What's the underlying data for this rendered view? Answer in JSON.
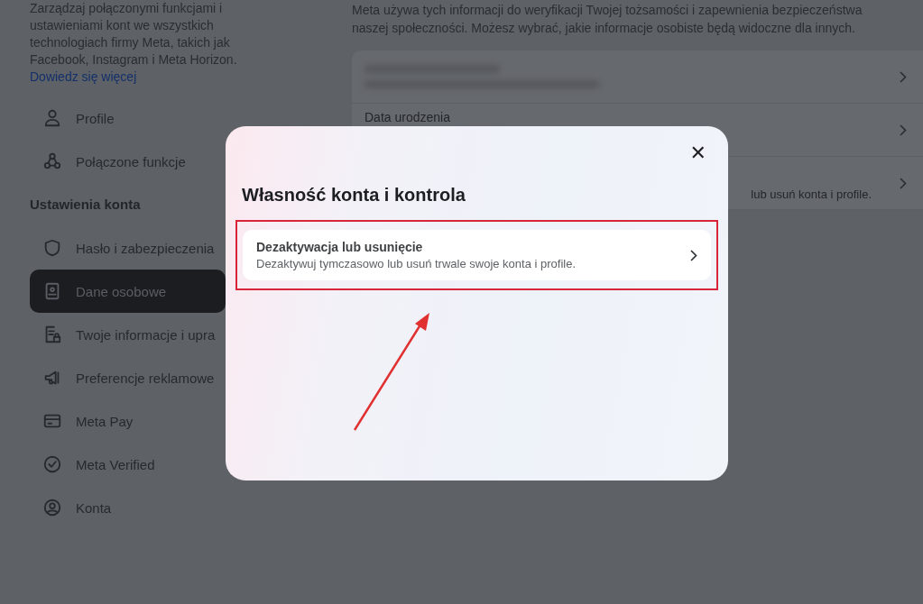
{
  "sidebar": {
    "intro": "Zarządzaj połączonymi funkcjami i ustawieniami kont we wszystkich technologiach firmy Meta, takich jak Facebook, Instagram i Meta Horizon.",
    "learn_more_link": "Dowiedz się więcej",
    "items": [
      {
        "label": "Profile",
        "selected": false
      },
      {
        "label": "Połączone funkcje",
        "selected": false
      }
    ],
    "section_title": "Ustawienia konta",
    "section_items": [
      {
        "label": "Hasło i zabezpieczenia",
        "selected": false
      },
      {
        "label": "Dane osobowe",
        "selected": true
      },
      {
        "label": "Twoje informacje i upra",
        "selected": false
      },
      {
        "label": "Preferencje reklamowe",
        "selected": false
      },
      {
        "label": "Meta Pay",
        "selected": false
      },
      {
        "label": "Meta Verified",
        "selected": false
      },
      {
        "label": "Konta",
        "selected": false
      }
    ]
  },
  "main": {
    "description": "Meta używa tych informacji do weryfikacji Twojej tożsamości i zapewnienia bezpieczeństwa naszej społeczności. Możesz wybrać, jakie informacje osobiste będą widoczne dla innych.",
    "rows": [
      {
        "kind": "redacted"
      },
      {
        "kind": "field",
        "label": "Data urodzenia"
      },
      {
        "kind": "partial",
        "text": "lub usuń konta i profile."
      }
    ]
  },
  "dialog": {
    "title": "Własność konta i kontrola",
    "close": "✕",
    "options": [
      {
        "title": "Dezaktywacja lub usunięcie",
        "description": "Dezaktywuj tymczasowo lub usuń trwale swoje konta i profile.",
        "highlighted": true
      }
    ]
  }
}
